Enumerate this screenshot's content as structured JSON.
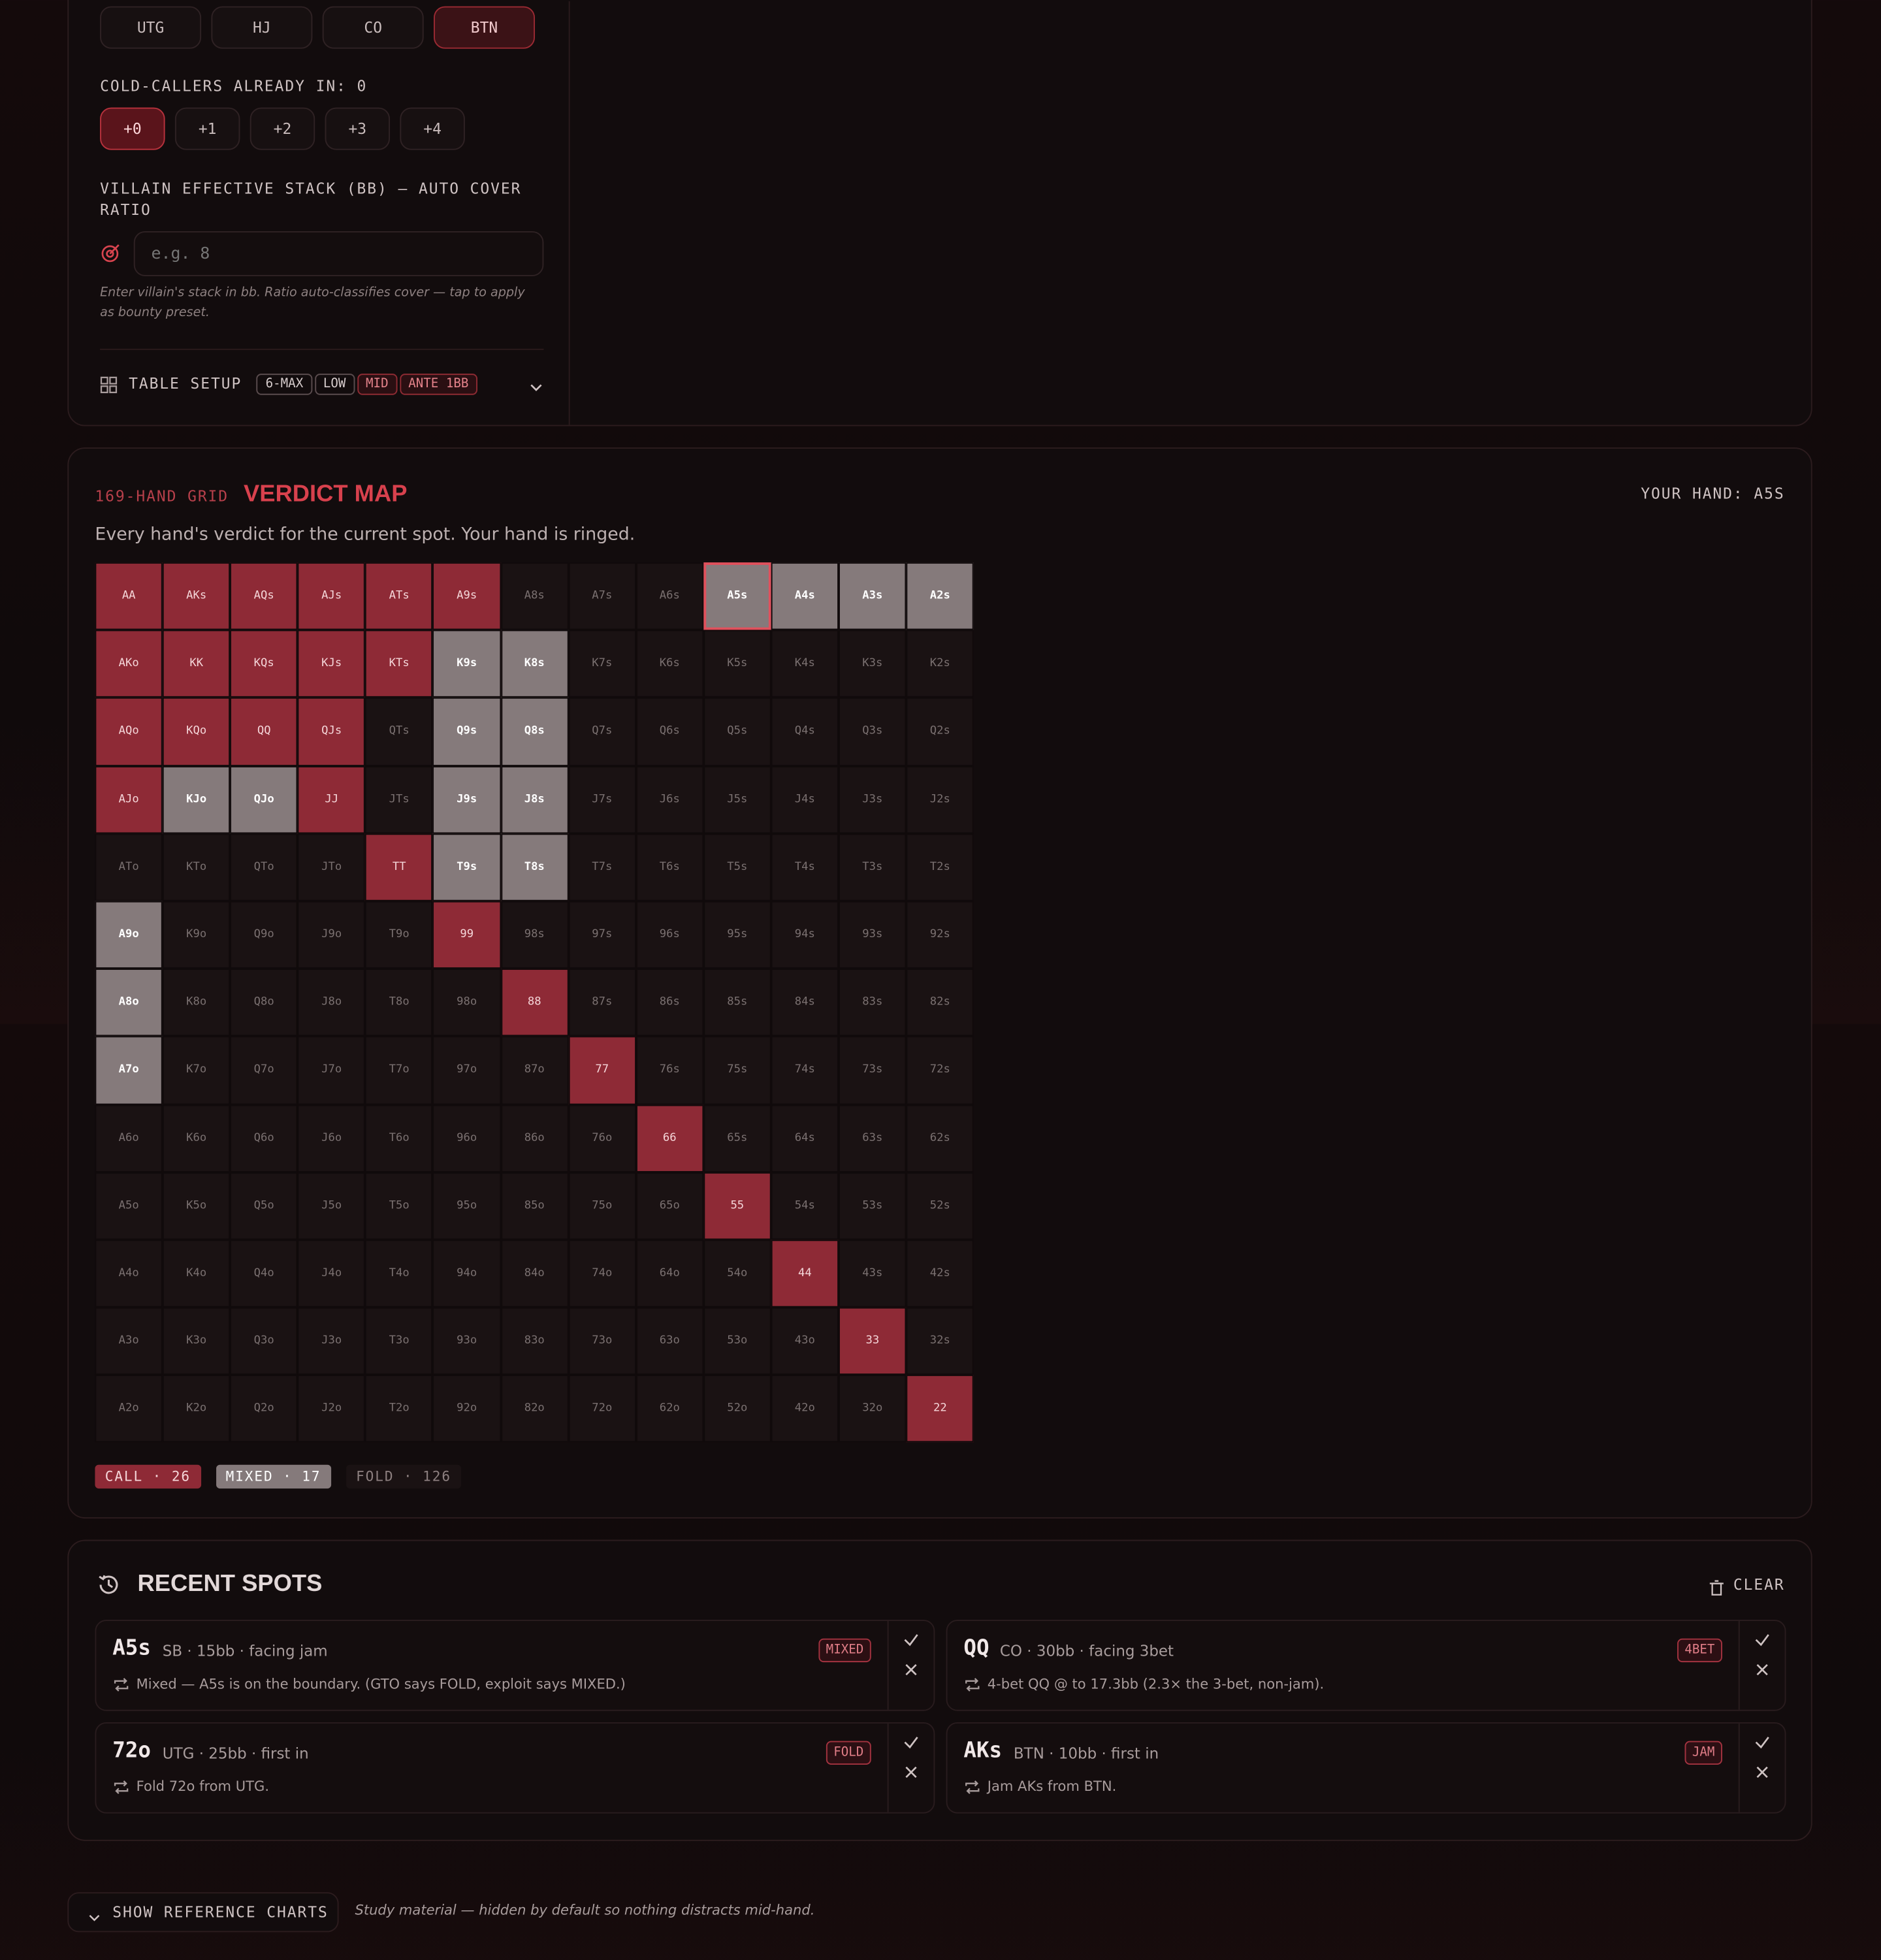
{
  "positions": {
    "buttons": [
      "UTG",
      "HJ",
      "CO",
      "BTN"
    ],
    "active": "BTN"
  },
  "cold_callers": {
    "label": "COLD-CALLERS ALREADY IN: 0",
    "options": [
      "+0",
      "+1",
      "+2",
      "+3",
      "+4"
    ],
    "active": "+0"
  },
  "villain_stack": {
    "label": "VILLAIN EFFECTIVE STACK (BB) — AUTO COVER RATIO",
    "placeholder": "e.g. 8",
    "hint": "Enter villain's stack in bb. Ratio auto-classifies cover — tap to apply as bounty preset."
  },
  "table_setup": {
    "label": "TABLE SETUP",
    "chips": [
      "6-MAX",
      "LOW",
      "MID",
      "ANTE 1BB"
    ],
    "highlighted_chips": [
      "MID",
      "ANTE 1BB"
    ]
  },
  "verdict_map": {
    "eyebrow": "169-HAND GRID",
    "title": "VERDICT MAP",
    "your_hand": "YOUR HAND: A5S",
    "subtitle": "Every hand's verdict for the current spot. Your hand is ringed.",
    "ranks": [
      "A",
      "K",
      "Q",
      "J",
      "T",
      "9",
      "8",
      "7",
      "6",
      "5",
      "4",
      "3",
      "2"
    ],
    "call_hands": [
      "AA",
      "AKs",
      "AQs",
      "AJs",
      "ATs",
      "A9s",
      "AKo",
      "KK",
      "KQs",
      "KJs",
      "KTs",
      "AQo",
      "KQo",
      "QQ",
      "QJs",
      "AJo",
      "JJ",
      "TT",
      "99",
      "88",
      "77",
      "66",
      "55",
      "44",
      "33",
      "22"
    ],
    "mixed_hands": [
      "A5s",
      "A4s",
      "A3s",
      "A2s",
      "K9s",
      "K8s",
      "Q9s",
      "Q8s",
      "KJo",
      "QJo",
      "J9s",
      "J8s",
      "T9s",
      "T8s",
      "A9o",
      "A8o",
      "A7o"
    ],
    "your_hand_code": "A5s",
    "legend": {
      "call": "CALL · 26",
      "mixed": "MIXED · 17",
      "fold": "FOLD · 126"
    },
    "colors": {
      "call": "#8e2a36",
      "mixed": "#857a7b",
      "fold": "#1a1213",
      "ring": "#e0505c"
    }
  },
  "recent_spots": {
    "title": "RECENT SPOTS",
    "clear_label": "CLEAR",
    "items": [
      {
        "hand": "A5s",
        "meta": "SB · 15bb · facing jam",
        "badge": "MIXED",
        "note": "Mixed — A5s is on the boundary. (GTO says FOLD, exploit says MIXED.)"
      },
      {
        "hand": "QQ",
        "meta": "CO · 30bb · facing 3bet",
        "badge": "4BET",
        "note": "4-bet QQ @ to 17.3bb (2.3× the 3-bet, non-jam)."
      },
      {
        "hand": "72o",
        "meta": "UTG · 25bb · first in",
        "badge": "FOLD",
        "note": "Fold 72o from UTG."
      },
      {
        "hand": "AKs",
        "meta": "BTN · 10bb · first in",
        "badge": "JAM",
        "note": "Jam AKs from BTN."
      }
    ]
  },
  "reference": {
    "button_label": "SHOW REFERENCE CHARTS",
    "note": "Study material — hidden by default so nothing distracts mid-hand."
  }
}
